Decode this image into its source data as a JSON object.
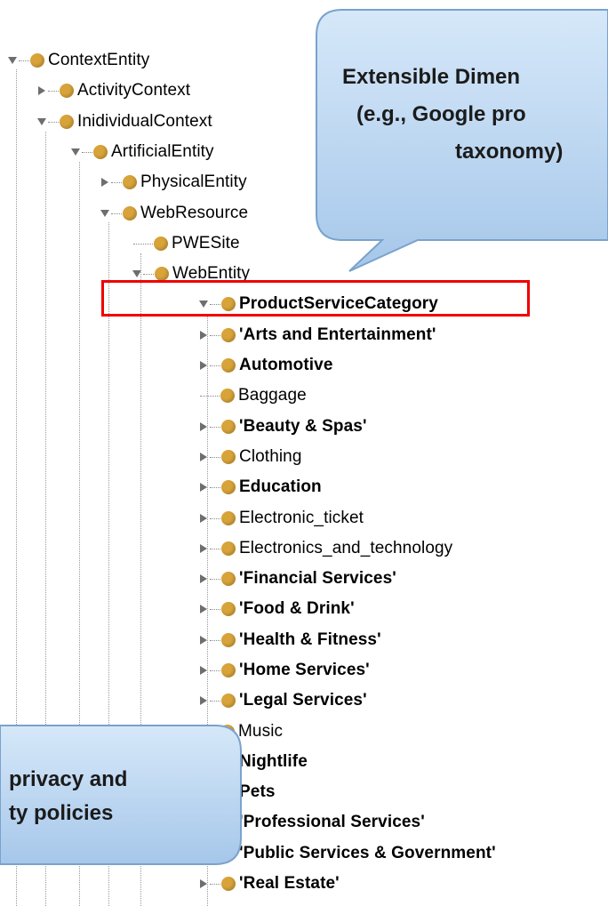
{
  "tree": {
    "nodes": [
      {
        "label": "ContextEntity",
        "toggle": "expanded",
        "bold": false
      },
      {
        "label": "ActivityContext",
        "toggle": "collapsed",
        "bold": false
      },
      {
        "label": "InidividualContext",
        "toggle": "expanded",
        "bold": false
      },
      {
        "label": "ArtificialEntity",
        "toggle": "expanded",
        "bold": false
      },
      {
        "label": "PhysicalEntity",
        "toggle": "collapsed",
        "bold": false
      },
      {
        "label": "WebResource",
        "toggle": "expanded",
        "bold": false
      },
      {
        "label": "PWESite",
        "toggle": "leaf",
        "bold": false
      },
      {
        "label": "WebEntity",
        "toggle": "expanded",
        "bold": false
      },
      {
        "label": "ProductServiceCategory",
        "toggle": "expanded",
        "bold": true
      },
      {
        "label": "'Arts and Entertainment'",
        "toggle": "collapsed",
        "bold": true
      },
      {
        "label": "Automotive",
        "toggle": "collapsed",
        "bold": true
      },
      {
        "label": "Baggage",
        "toggle": "leaf",
        "bold": false
      },
      {
        "label": "'Beauty & Spas'",
        "toggle": "collapsed",
        "bold": true
      },
      {
        "label": "Clothing",
        "toggle": "collapsed",
        "bold": false
      },
      {
        "label": "Education",
        "toggle": "collapsed",
        "bold": true
      },
      {
        "label": "Electronic_ticket",
        "toggle": "collapsed",
        "bold": false
      },
      {
        "label": "Electronics_and_technology",
        "toggle": "collapsed",
        "bold": false
      },
      {
        "label": "'Financial Services'",
        "toggle": "collapsed",
        "bold": true
      },
      {
        "label": "'Food & Drink'",
        "toggle": "collapsed",
        "bold": true
      },
      {
        "label": "'Health & Fitness'",
        "toggle": "collapsed",
        "bold": true
      },
      {
        "label": "'Home Services'",
        "toggle": "collapsed",
        "bold": true
      },
      {
        "label": "'Legal Services'",
        "toggle": "collapsed",
        "bold": true
      },
      {
        "label": "Music",
        "toggle": "leaf",
        "bold": false
      },
      {
        "label": "Nightlife",
        "toggle": "collapsed",
        "bold": true
      },
      {
        "label": "Pets",
        "toggle": "collapsed",
        "bold": true
      },
      {
        "label": "'Professional Services'",
        "toggle": "collapsed",
        "bold": true
      },
      {
        "label": "'Public Services & Government'",
        "toggle": "collapsed",
        "bold": true
      },
      {
        "label": "'Real Estate'",
        "toggle": "collapsed",
        "bold": true
      }
    ]
  },
  "callouts": {
    "top_line1": "Extensible Dimen",
    "top_line2": "(e.g., Google pro",
    "top_line3": "taxonomy)",
    "bottom_line1": "privacy and",
    "bottom_line2": "ty policies"
  },
  "colors": {
    "node_dot": "#d8a43a",
    "selection_border": "#f00000",
    "callout_fill": "#b8d4f0"
  }
}
